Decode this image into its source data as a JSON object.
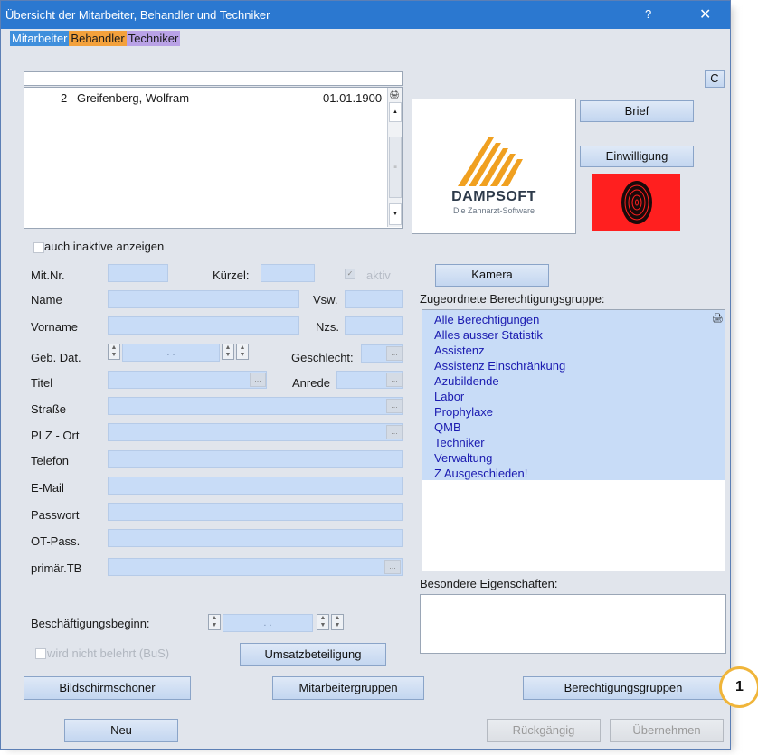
{
  "window": {
    "title": "Übersicht der Mitarbeiter, Behandler und Techniker",
    "help": "?",
    "close": "✕"
  },
  "tabs": [
    "Mitarbeiter",
    "Behandler",
    "Techniker"
  ],
  "c_button": "C",
  "list": {
    "row": {
      "nr": "2",
      "name": "Greifenberg, Wolfram",
      "date": "01.01.1900"
    }
  },
  "inaktive_label": "auch inaktive anzeigen",
  "logo": {
    "brand": "DAMPSOFT",
    "tagline": "Die Zahnarzt-Software"
  },
  "buttons": {
    "brief": "Brief",
    "einwilligung": "Einwilligung",
    "kamera": "Kamera",
    "umsatz": "Umsatzbeteiligung",
    "bildschirmschoner": "Bildschirmschoner",
    "mitarbeitergruppen": "Mitarbeitergruppen",
    "berechtigungsgruppen": "Berechtigungsgruppen",
    "neu": "Neu",
    "rueckgaengig": "Rückgängig",
    "uebernehmen": "Übernehmen"
  },
  "labels": {
    "mitnr": "Mit.Nr.",
    "kuerzel": "Kürzel:",
    "aktiv": "aktiv",
    "name": "Name",
    "vsw": "Vsw.",
    "vorname": "Vorname",
    "nzs": "Nzs.",
    "gebdat": "Geb. Dat.",
    "geschlecht": "Geschlecht:",
    "titel": "Titel",
    "anrede": "Anrede",
    "strasse": "Straße",
    "plz": "PLZ - Ort",
    "telefon": "Telefon",
    "email": "E-Mail",
    "passwort": "Passwort",
    "otpass": "OT-Pass.",
    "primtb": "primär.TB",
    "beschbeginn": "Beschäftigungsbeginn:",
    "belehrt": "wird nicht belehrt (BuS)",
    "zugeordnet": "Zugeordnete Berechtigungsgruppe:",
    "besondere": "Besondere Eigenschaften:"
  },
  "date_placeholder": ". .",
  "groups": [
    "Alle Berechtigungen",
    "Alles ausser Statistik",
    "Assistenz",
    "Assistenz Einschränkung",
    "Azubildende",
    "Labor",
    "Prophylaxe",
    "QMB",
    "Techniker",
    "Verwaltung",
    "Z Ausgeschieden!"
  ],
  "callout": "1",
  "colors": {
    "titlebar": "#2b78d0",
    "field": "#c8dcf7",
    "callout": "#f0b53a",
    "fingerprint_bg": "#ff1f1f",
    "logo": "#f0a020"
  }
}
